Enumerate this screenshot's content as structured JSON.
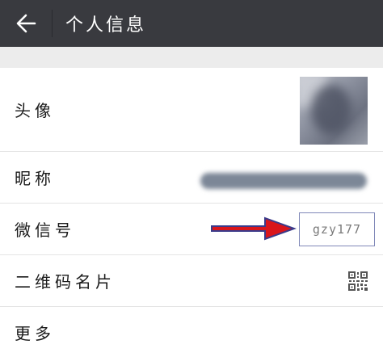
{
  "header": {
    "back_icon": "arrow-left-icon",
    "title": "个人信息",
    "background": "#393a3f"
  },
  "profile": {
    "avatar": {
      "label": "头像"
    },
    "nickname": {
      "label": "昵称"
    },
    "wechat_id": {
      "label": "微信号",
      "value": "gzy177",
      "highlight_color": "#d9151b"
    },
    "qr_code": {
      "label": "二维码名片",
      "icon": "qr-code-icon"
    },
    "more": {
      "label": "更多"
    }
  }
}
